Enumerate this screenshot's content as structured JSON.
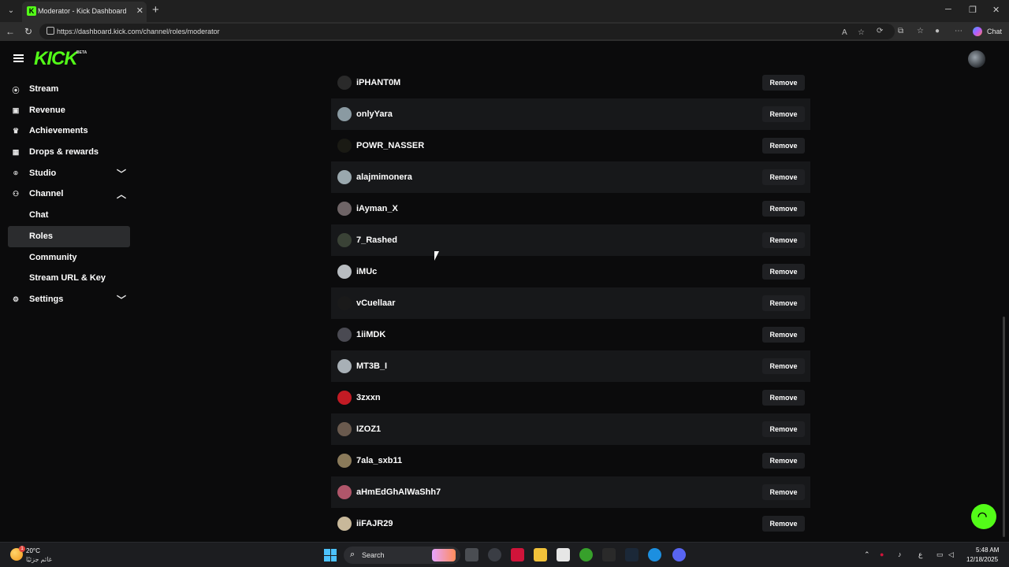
{
  "browser": {
    "tab_title": "Moderator - Kick Dashboard",
    "url": "https://dashboard.kick.com/channel/roles/moderator",
    "chat_label": "Chat"
  },
  "header": {
    "logo": "KICK",
    "logo_badge": "BETA"
  },
  "sidebar": {
    "items": [
      {
        "label": "Stream",
        "icon": "broadcast-icon"
      },
      {
        "label": "Revenue",
        "icon": "revenue-icon"
      },
      {
        "label": "Achievements",
        "icon": "trophy-icon"
      },
      {
        "label": "Drops & rewards",
        "icon": "gift-icon"
      },
      {
        "label": "Studio",
        "icon": "studio-icon",
        "expandable": true,
        "expanded": false
      },
      {
        "label": "Channel",
        "icon": "channel-icon",
        "expandable": true,
        "expanded": true
      },
      {
        "label": "Chat",
        "sub": true
      },
      {
        "label": "Roles",
        "sub": true,
        "active": true
      },
      {
        "label": "Community",
        "sub": true
      },
      {
        "label": "Stream URL & Key",
        "sub": true
      },
      {
        "label": "Settings",
        "icon": "gear-icon",
        "expandable": true,
        "expanded": false
      }
    ]
  },
  "moderators": {
    "remove_label": "Remove",
    "rows": [
      {
        "name": "iPHANT0M",
        "avatar_color": "#2a2a2a"
      },
      {
        "name": "onlyYara",
        "avatar_color": "#8a9aa2"
      },
      {
        "name": "POWR_NASSER",
        "avatar_color": "#1a1a14"
      },
      {
        "name": "alajmimonera",
        "avatar_color": "#9aa8ae"
      },
      {
        "name": "iAyman_X",
        "avatar_color": "#6e6466"
      },
      {
        "name": "7_Rashed",
        "avatar_color": "#3a4236"
      },
      {
        "name": "iMUc",
        "avatar_color": "#b8bcc0"
      },
      {
        "name": "vCuellaar",
        "avatar_color": "#1a1a1a"
      },
      {
        "name": "1iiMDK",
        "avatar_color": "#4a4a52"
      },
      {
        "name": "MT3B_I",
        "avatar_color": "#a8b0b6"
      },
      {
        "name": "3zxxn",
        "avatar_color": "#c21b24"
      },
      {
        "name": "IZOZ1",
        "avatar_color": "#6a5a4e"
      },
      {
        "name": "7ala_sxb11",
        "avatar_color": "#8a7a5a"
      },
      {
        "name": "aHmEdGhAlWaShh7",
        "avatar_color": "#b0566a"
      },
      {
        "name": "iiFAJR29",
        "avatar_color": "#c8b89a"
      }
    ]
  },
  "taskbar": {
    "weather_temp": "20°C",
    "weather_desc": "غائم جزئيًا",
    "search_placeholder": "Search",
    "time": "5:48 AM",
    "date": "12/18/2025",
    "lang": "ع"
  },
  "colors": {
    "accent": "#53fc18",
    "row_alt": "#17181a",
    "background": "#0b0b0c"
  }
}
